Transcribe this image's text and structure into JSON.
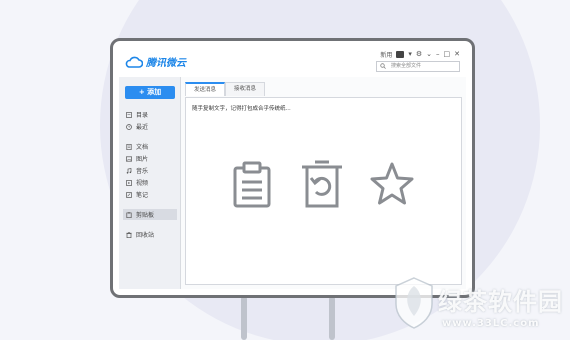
{
  "app": {
    "name": "腾讯微云"
  },
  "titlebar": {
    "user_label": "新用",
    "search_placeholder": "搜索全部文件"
  },
  "sidebar": {
    "add_button": "+ 添加",
    "items": [
      {
        "label": "目录",
        "icon": "folder-icon"
      },
      {
        "label": "最近",
        "icon": "clock-icon"
      },
      {
        "label": "文档",
        "icon": "document-icon"
      },
      {
        "label": "图片",
        "icon": "image-icon"
      },
      {
        "label": "音乐",
        "icon": "music-icon"
      },
      {
        "label": "视频",
        "icon": "video-icon"
      },
      {
        "label": "笔记",
        "icon": "note-icon"
      },
      {
        "label": "剪贴板",
        "icon": "clipboard-icon",
        "active": true
      },
      {
        "label": "回收站",
        "icon": "trash-icon"
      }
    ]
  },
  "content": {
    "tabs": [
      {
        "label": "发送消息",
        "active": true
      },
      {
        "label": "接收消息",
        "active": false
      }
    ],
    "hint": "随手复制文字，记得打包成合乎传统纸..."
  },
  "watermark": {
    "text": "绿茶软件园",
    "url": "www.33LC.com"
  },
  "colors": {
    "accent": "#2b8df0",
    "frame": "#6f7175",
    "sidebar_bg": "#eef0f4"
  }
}
